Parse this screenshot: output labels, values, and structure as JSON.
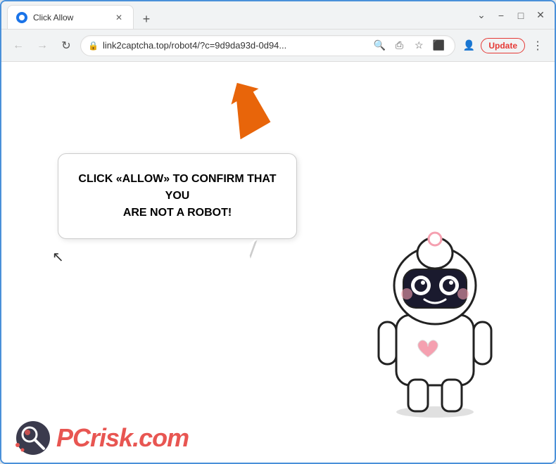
{
  "browser": {
    "tab_title": "Click Allow",
    "tab_favicon": "globe",
    "new_tab_label": "+",
    "window_controls": {
      "minimize": "−",
      "maximize": "□",
      "close": "✕"
    },
    "nav": {
      "back": "←",
      "forward": "→",
      "reload": "↻"
    },
    "address": "link2captcha.top/robot4/?c=9d9da93d-0d94...",
    "address_icons": {
      "search": "🔍",
      "share": "⎙",
      "bookmark": "☆",
      "sidebar": "⬜",
      "profile": "👤"
    },
    "update_button": "Update",
    "menu_button": "⋮"
  },
  "page": {
    "bubble_line1": "CLICK «ALLOW» TO CONFIRM THAT YOU",
    "bubble_line2": "ARE NOT A ROBOT!",
    "watermark_prefix": "PC",
    "watermark_suffix": "risk.com"
  },
  "colors": {
    "arrow_orange": "#e8650a",
    "update_red": "#e53935",
    "browser_border": "#4a90d9",
    "tab_bg": "#ffffff",
    "toolbar_bg": "#f1f3f4"
  }
}
